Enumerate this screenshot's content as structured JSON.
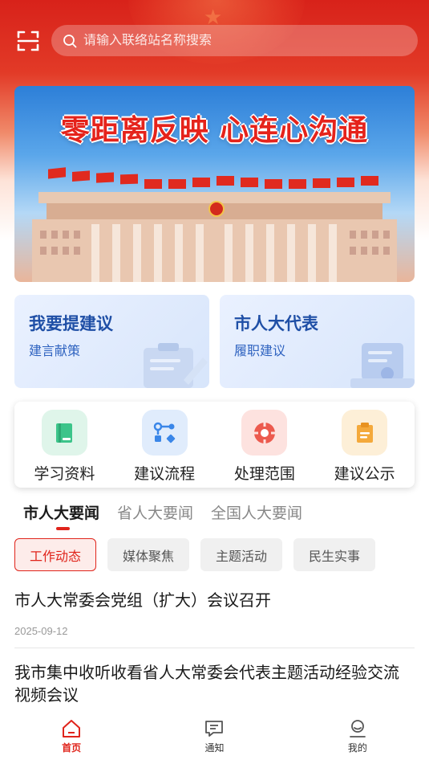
{
  "search": {
    "placeholder": "请输入联络站名称搜索"
  },
  "banner": {
    "slogan": "零距离反映  心连心沟通"
  },
  "cards": [
    {
      "title": "我要提建议",
      "subtitle": "建言献策"
    },
    {
      "title": "市人大代表",
      "subtitle": "履职建议"
    }
  ],
  "quick_menu": [
    {
      "label": "学习资料",
      "icon": "book-icon",
      "color": "#3cc48a"
    },
    {
      "label": "建议流程",
      "icon": "flow-icon",
      "color": "#3a86e8"
    },
    {
      "label": "处理范围",
      "icon": "target-icon",
      "color": "#ec5a4e"
    },
    {
      "label": "建议公示",
      "icon": "clipboard-icon",
      "color": "#f4a93b"
    }
  ],
  "news_tabs": [
    "市人大要闻",
    "省人大要闻",
    "全国人大要闻"
  ],
  "filter_chips": [
    "工作动态",
    "媒体聚焦",
    "主题活动",
    "民生实事"
  ],
  "news": [
    {
      "title": "市人大常委会党组（扩大）会议召开",
      "date": "2025-09-12"
    },
    {
      "title": "我市集中收听收看省人大常委会代表主题活动经验交流视频会议",
      "date": ""
    }
  ],
  "bottom_nav": [
    {
      "label": "首页",
      "icon": "home-icon",
      "active": true
    },
    {
      "label": "通知",
      "icon": "message-icon",
      "active": false
    },
    {
      "label": "我的",
      "icon": "user-icon",
      "active": false
    }
  ],
  "colors": {
    "primary": "#e0241b",
    "header": "#d8221a",
    "card_title": "#1f4fa6"
  }
}
